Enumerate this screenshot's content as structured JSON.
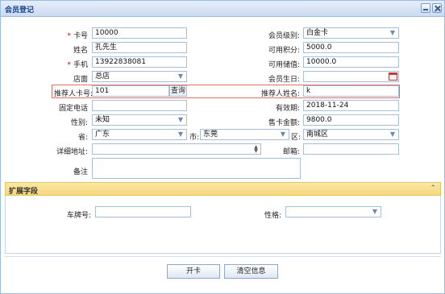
{
  "window": {
    "title": "会员登记"
  },
  "form": {
    "card_no": {
      "label": "卡号",
      "value": "10000"
    },
    "member_level": {
      "label": "会员级别:",
      "value": "白金卡"
    },
    "name": {
      "label": "姓名",
      "value": "孔先生"
    },
    "available_points": {
      "label": "可用积分:",
      "value": "5000.0"
    },
    "phone": {
      "label": "手机",
      "value": "13922838081"
    },
    "available_value": {
      "label": "可用储值:",
      "value": "10000.0"
    },
    "store": {
      "label": "店面",
      "value": "总店"
    },
    "birthday": {
      "label": "会员生日:",
      "value": ""
    },
    "referrer_card": {
      "label": "推荐人卡号:",
      "value": "101",
      "button": "查询"
    },
    "referrer_name": {
      "label": "推荐人姓名:",
      "value": "k"
    },
    "landline": {
      "label": "固定电话",
      "value": ""
    },
    "expiry": {
      "label": "有效期:",
      "value": "2018-11-24"
    },
    "gender": {
      "label": "性别:",
      "value": "未知"
    },
    "card_price": {
      "label": "售卡金额:",
      "value": "9800.0"
    },
    "province": {
      "label": "省:",
      "value": "广东"
    },
    "city": {
      "label": "市:",
      "value": "东莞"
    },
    "district": {
      "label": "区:",
      "value": "南城区"
    },
    "address": {
      "label": "详细地址:",
      "value": ""
    },
    "email": {
      "label": "邮箱:",
      "value": ""
    },
    "remark": {
      "label": "备注",
      "value": ""
    }
  },
  "extension": {
    "title": "扩展字段",
    "plate_no": {
      "label": "车牌号:",
      "value": ""
    },
    "gender": {
      "label": "性格:",
      "value": ""
    }
  },
  "buttons": {
    "open_card": "开卡",
    "clear_info": "清空信息"
  },
  "colors": {
    "title_text": "#15428b",
    "required_mark": "#d40000",
    "section_header": "#f5d77d",
    "highlight_border": "#e07070"
  }
}
